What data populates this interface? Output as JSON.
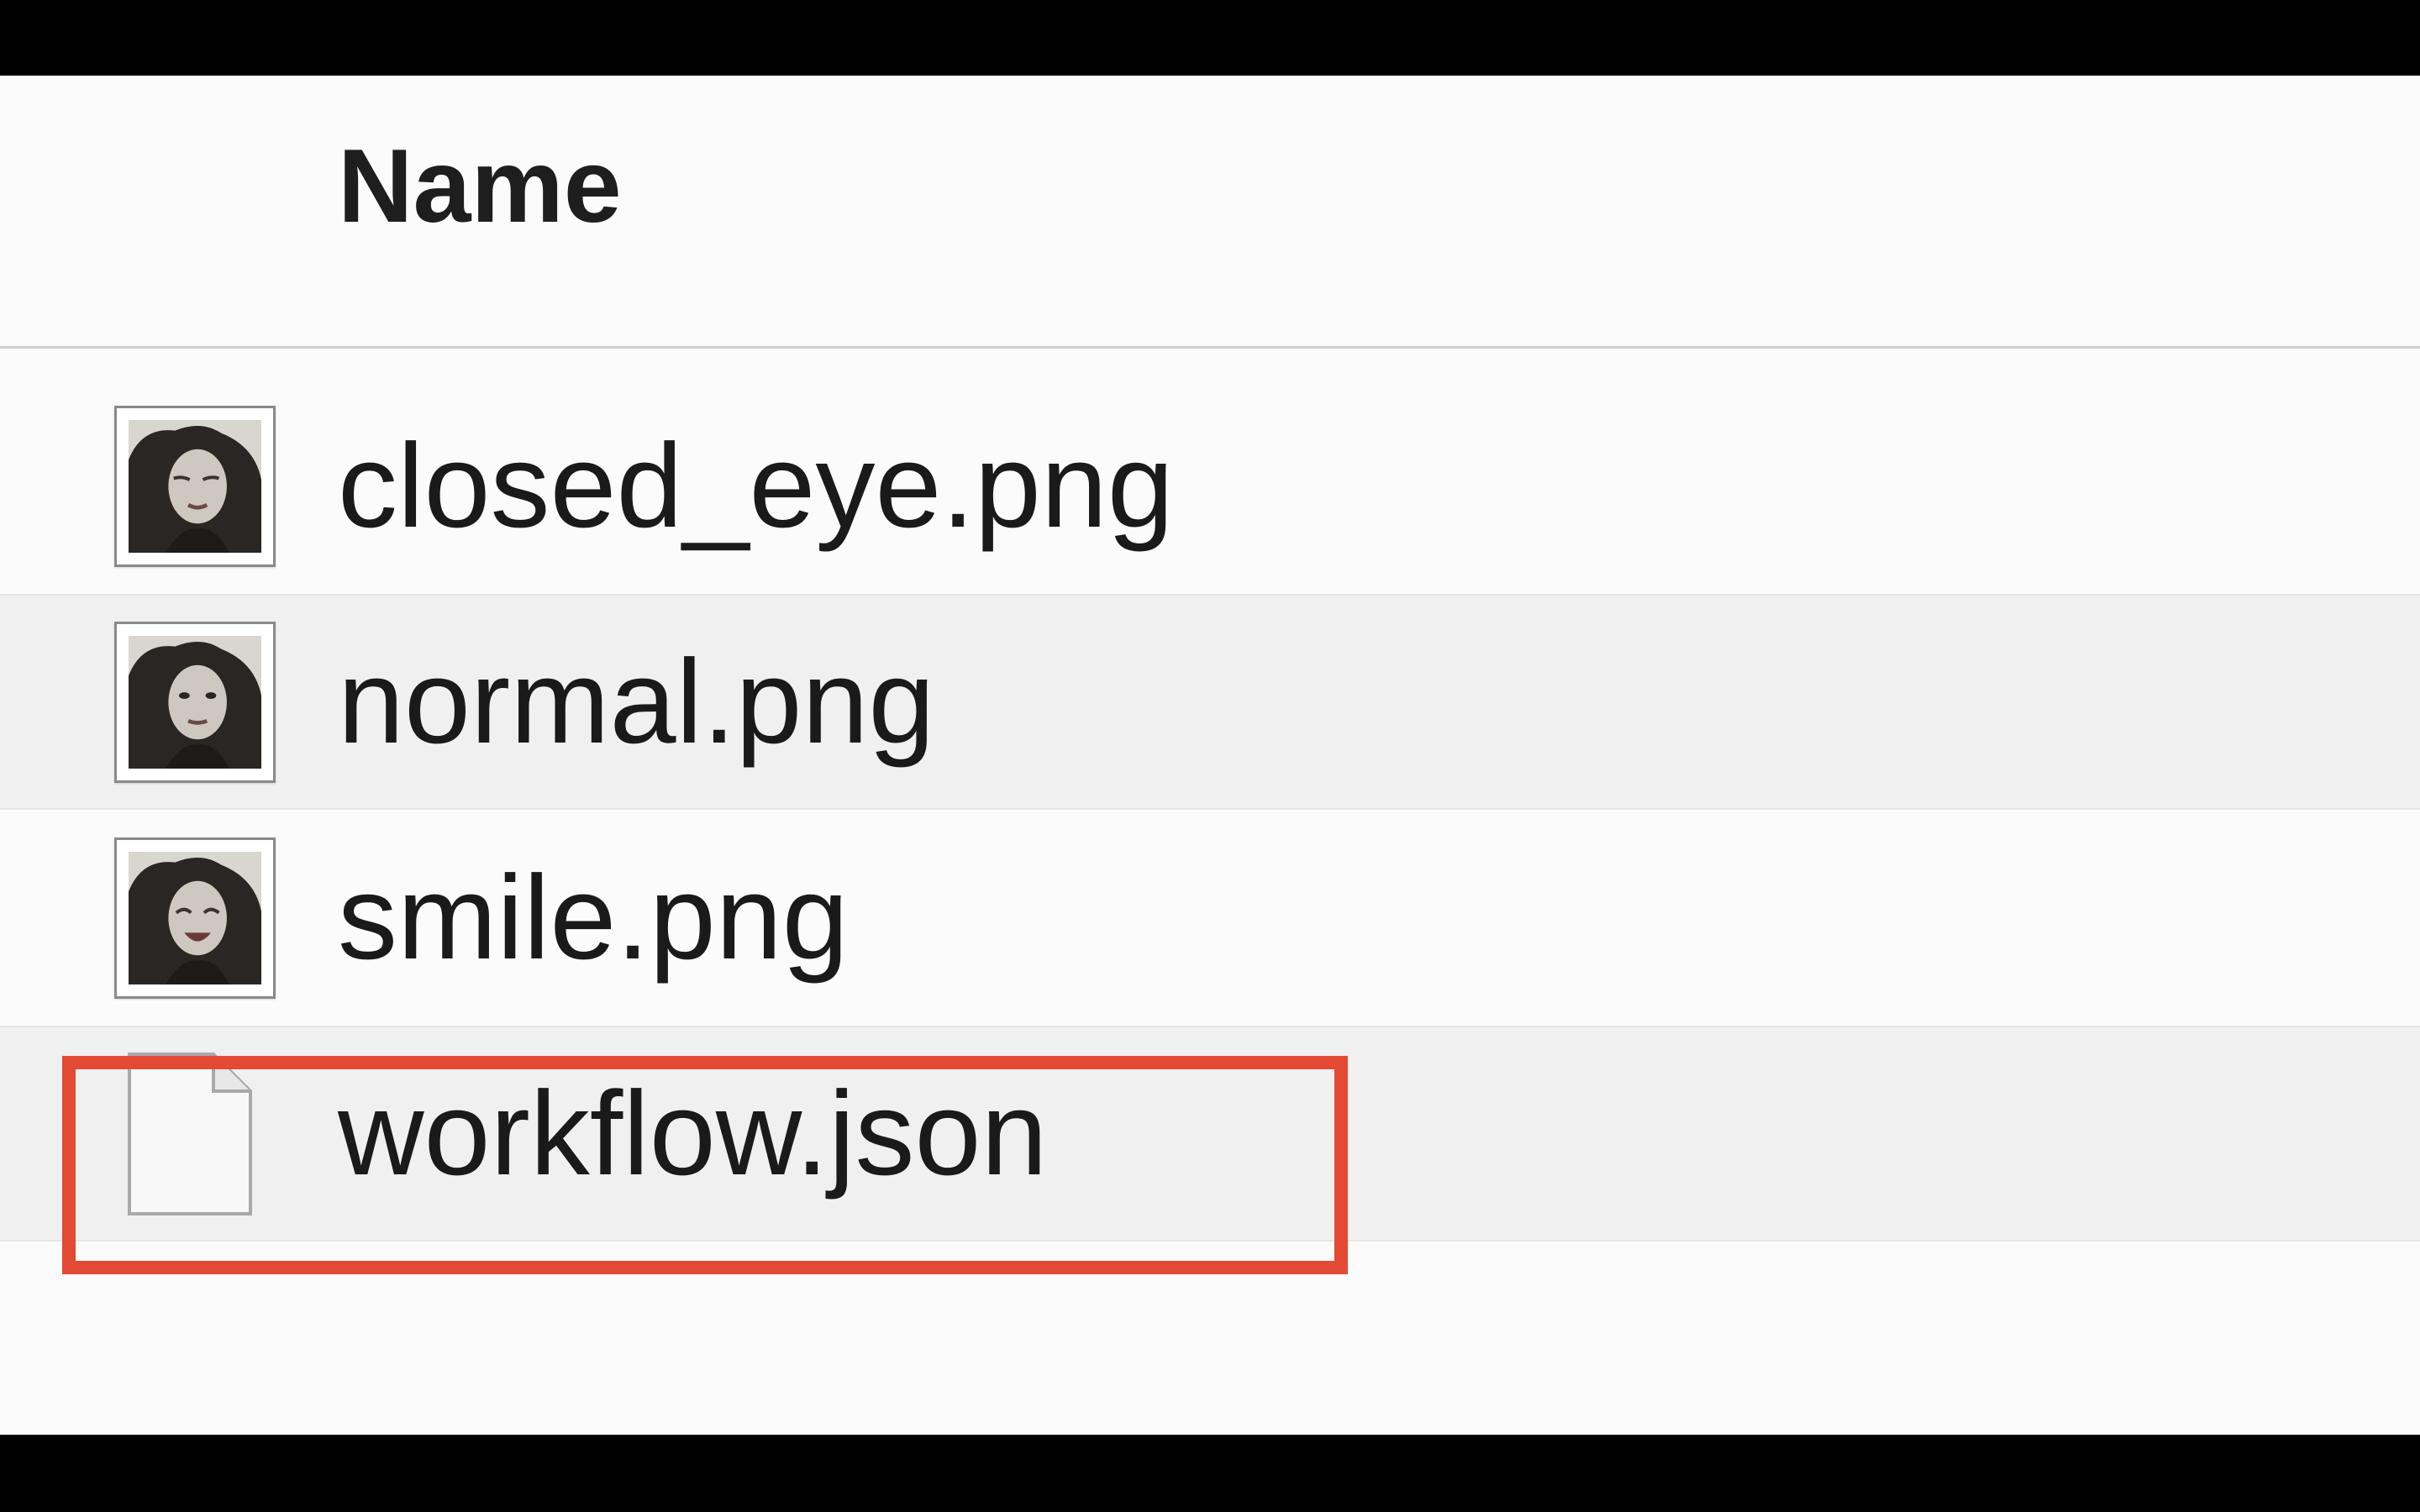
{
  "header": {
    "name_column_label": "Name"
  },
  "files": [
    {
      "name": "closed_eye.png",
      "icon": "image-thumbnail-icon",
      "alternate": false
    },
    {
      "name": "normal.png",
      "icon": "image-thumbnail-icon",
      "alternate": true
    },
    {
      "name": "smile.png",
      "icon": "image-thumbnail-icon",
      "alternate": false
    },
    {
      "name": "workflow.json",
      "icon": "document-icon",
      "alternate": true
    }
  ],
  "annotation": {
    "highlight_color": "#e34a33",
    "highlighted_file": "workflow.json"
  }
}
